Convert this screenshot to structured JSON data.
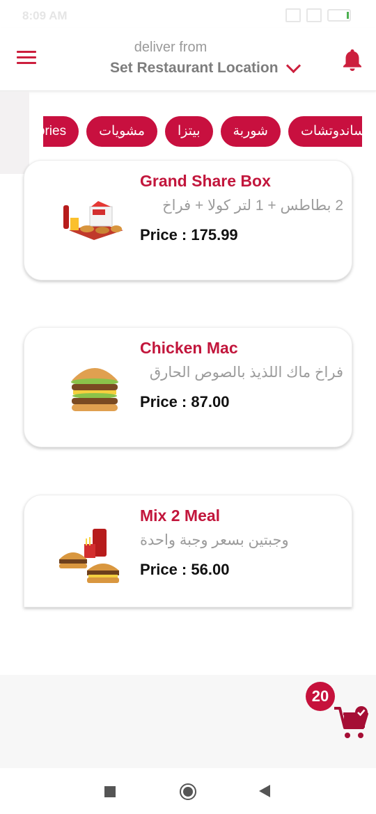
{
  "status_bar": {
    "time": "8:09 AM"
  },
  "header": {
    "deliver_label": "deliver from",
    "location": "Set Restaurant Location"
  },
  "categories": [
    "categories",
    "مشويات",
    "بيتزا",
    "شوربة",
    "ساندوتشات"
  ],
  "products": [
    {
      "title": "Grand Share Box",
      "description": "2 بطاطس + 1 لتر كولا + فراخ",
      "price": "Price : 175.99",
      "image": "meal-box-image"
    },
    {
      "title": "Chicken Mac",
      "description": "فراخ ماك اللذيذ بالصوص الحارق",
      "price": "Price : 87.00",
      "image": "burger-image"
    },
    {
      "title": "Mix 2 Meal",
      "description": "وجبتين بسعر وجبة واحدة",
      "price": "Price : 56.00",
      "image": "two-burgers-image"
    }
  ],
  "cart": {
    "count": "20"
  },
  "colors": {
    "accent": "#c8103f",
    "price_text": "#111111",
    "desc_text": "#9b9b9b"
  }
}
